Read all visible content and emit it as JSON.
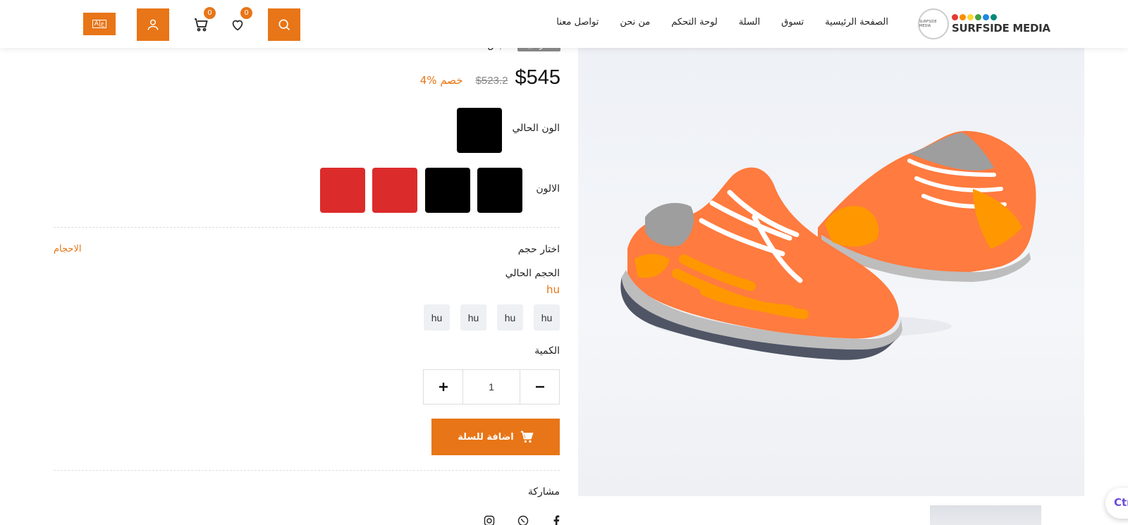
{
  "header": {
    "logo_text": "SURFSIDE MEDIA",
    "logo_badge_text": "SURFSIDE MEDIA",
    "nav": [
      {
        "label": "الصفحة الرئيسية"
      },
      {
        "label": "تسوق"
      },
      {
        "label": "السلة"
      },
      {
        "label": "لوحة التحكم"
      },
      {
        "label": "من نحن"
      },
      {
        "label": "تواصل معنا"
      }
    ],
    "wishlist_count": "0",
    "cart_count": "0",
    "lang_label": "A|ع",
    "accent_color": "#e87517",
    "icons": [
      "search-icon",
      "heart-icon",
      "cart-icon",
      "user-icon",
      "language-icon"
    ]
  },
  "product": {
    "tag": "الأكثر مبيعا",
    "brand": "ملابس",
    "price": "$545",
    "old_price": "$523.2",
    "discount": "4% خصم",
    "current_color_label": "الون الحالي",
    "current_color": "#000000",
    "colors_label": "الالون",
    "colors": [
      "#000000",
      "#000000",
      "#dc2b2b",
      "#dc2b2b"
    ],
    "choose_size_label": "اختار حجم",
    "sizes_link": "الاحجام",
    "current_size_label": "الحجم الحالي",
    "current_size": "hu",
    "sizes": [
      "hu",
      "hu",
      "hu",
      "hu"
    ],
    "quantity_label": "الكمية",
    "quantity": "1",
    "add_to_cart": "اضافة للسلة",
    "share_label": "مشاركة"
  },
  "chat_widget_label": "Ctrl"
}
